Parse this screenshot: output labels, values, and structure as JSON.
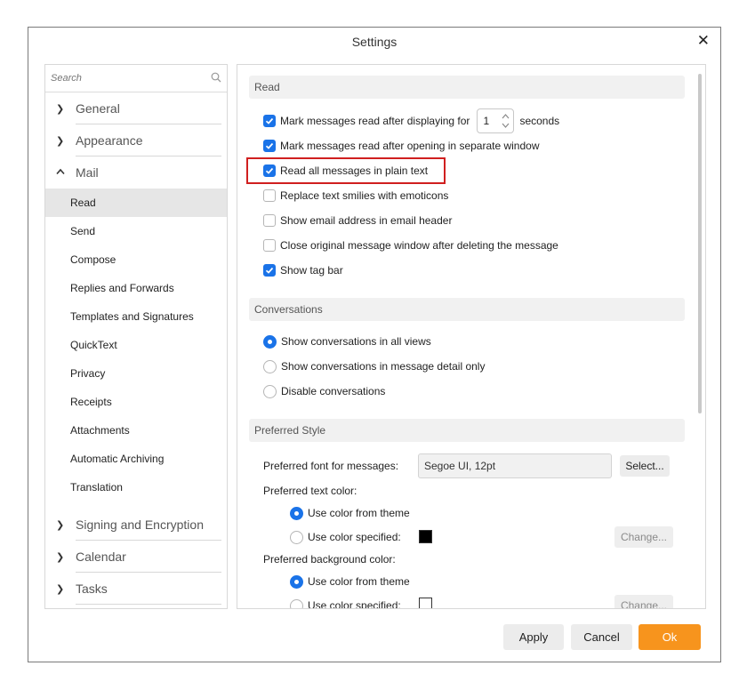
{
  "dialog": {
    "title": "Settings"
  },
  "sidebar": {
    "search_placeholder": "Search",
    "groups_top": [
      {
        "label": "General",
        "expanded": false
      },
      {
        "label": "Appearance",
        "expanded": false
      },
      {
        "label": "Mail",
        "expanded": true
      }
    ],
    "mail_items": [
      "Read",
      "Send",
      "Compose",
      "Replies and Forwards",
      "Templates and Signatures",
      "QuickText",
      "Privacy",
      "Receipts",
      "Attachments",
      "Automatic Archiving",
      "Translation"
    ],
    "active_item": "Read",
    "groups_bottom": [
      {
        "label": "Signing and Encryption"
      },
      {
        "label": "Calendar"
      },
      {
        "label": "Tasks"
      }
    ]
  },
  "read": {
    "header": "Read",
    "mark_after_prefix": "Mark messages read after displaying for",
    "mark_after_value": "1",
    "mark_after_suffix": "seconds",
    "mark_separate_window": "Mark messages read after opening in separate window",
    "plain_text": "Read all messages in plain text",
    "smilies": "Replace text smilies with emoticons",
    "show_email": "Show email address in email header",
    "close_original": "Close original message window after deleting the message",
    "tag_bar": "Show tag bar"
  },
  "conversations": {
    "header": "Conversations",
    "all_views": "Show conversations in all views",
    "detail_only": "Show conversations in message detail only",
    "disable": "Disable conversations"
  },
  "style": {
    "header": "Preferred Style",
    "font_label": "Preferred font for messages:",
    "font_value": "Segoe UI, 12pt",
    "select_button": "Select...",
    "text_color_label": "Preferred text color:",
    "use_theme": "Use color from theme",
    "use_specified": "Use color specified:",
    "change_button": "Change...",
    "bg_color_label": "Preferred background color:"
  },
  "footer": {
    "apply": "Apply",
    "cancel": "Cancel",
    "ok": "Ok"
  },
  "colors": {
    "accent": "#1a73e8",
    "ok_button": "#f7941d",
    "highlight_box": "#d01f1f",
    "text_swatch": "#000000",
    "bg_swatch": "#ffffff"
  }
}
